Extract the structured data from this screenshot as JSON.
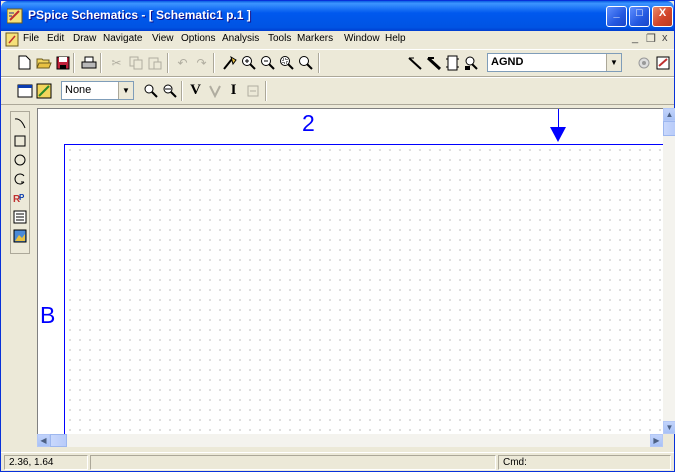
{
  "window": {
    "title": "PSpice Schematics - [ Schematic1  p.1  ]",
    "controls": {
      "minimize": "_",
      "maximize": "□",
      "close": "X"
    }
  },
  "menu": {
    "items": [
      "File",
      "Edit",
      "Draw",
      "Navigate",
      "View",
      "Options",
      "Analysis",
      "Tools",
      "Markers",
      "Window",
      "Help"
    ],
    "mdi_minimize": "_",
    "mdi_restore": "❐",
    "mdi_close": "x"
  },
  "toolbar1": {
    "part_combo_value": "AGND",
    "icons": [
      "new-icon",
      "open-icon",
      "save-icon",
      "print-icon",
      "cut-icon",
      "copy-icon",
      "paste-icon",
      "undo-icon",
      "redo-icon",
      "draw-wire-icon",
      "zoom-in-icon",
      "zoom-out-icon",
      "zoom-area-icon",
      "zoom-fit-icon",
      "wire-icon",
      "bus-icon",
      "block-icon",
      "get-part-icon",
      "setup-icon",
      "simulate-icon"
    ]
  },
  "toolbar2": {
    "marker_combo_value": "None",
    "voltage_marker": "V",
    "current_marker": "I"
  },
  "palette": {
    "icons": [
      "line-icon",
      "rectangle-icon",
      "circle-icon",
      "arc-icon",
      "text-icon",
      "text-box-icon",
      "picture-icon"
    ]
  },
  "canvas": {
    "zone_number": "2",
    "zone_letter": "B"
  },
  "status": {
    "coordinates": "2.36, 1.64",
    "cmd_label": "Cmd:"
  },
  "colors": {
    "schematic_border": "#0000ff",
    "titlebar": "#0054e3"
  }
}
